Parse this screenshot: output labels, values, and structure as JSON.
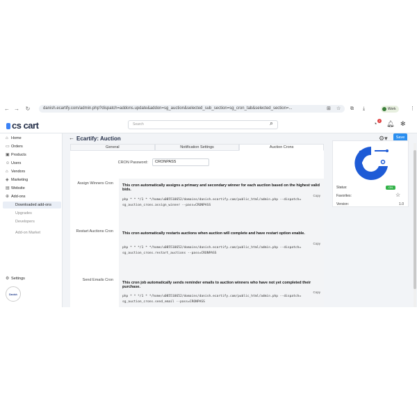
{
  "browser": {
    "url": "danish.ecartify.com/admin.php?dispatch=addons.update&addon=sg_auction&selected_sub_section=sg_cron_tab&selected_section=...",
    "profile_label": "Work"
  },
  "header": {
    "logo_text": "cs cart",
    "search_placeholder": "Search",
    "notification_count": "2"
  },
  "sidebar": {
    "items": [
      {
        "label": "Home",
        "icon": "home-icon"
      },
      {
        "label": "Orders",
        "icon": "orders-icon"
      },
      {
        "label": "Products",
        "icon": "products-icon"
      },
      {
        "label": "Users",
        "icon": "users-icon"
      },
      {
        "label": "Vendors",
        "icon": "vendors-icon"
      },
      {
        "label": "Marketing",
        "icon": "marketing-icon"
      },
      {
        "label": "Website",
        "icon": "website-icon"
      },
      {
        "label": "Add-ons",
        "icon": "addons-icon"
      },
      {
        "label": "Downloaded add-ons"
      },
      {
        "label": "Upgrades"
      },
      {
        "label": "Developers"
      },
      {
        "label": "Add-on Market"
      }
    ],
    "settings_label": "Settings",
    "avatar_text": "Danish Sharma"
  },
  "page": {
    "title": "Ecartify: Auction",
    "save_label": "Save",
    "tabs": [
      "General",
      "Notification Settings",
      "Auction Crons"
    ]
  },
  "cron": {
    "password_label": "CRON Password:",
    "password_value": "CRONPASS",
    "copy_label": "Copy",
    "blocks": [
      {
        "label": "Assign Winners Cron",
        "description": "This cron automatically assigns a primary and secondary winner for each auction based on the highest valid bids.",
        "command_line1": "php * * */1 * */home/u085510652/domains/danish.ecartify.com/public_html/admin.php --dispatch=",
        "command_line2": "sg_auction_crons.assign_winner --pass=CRONPASS"
      },
      {
        "label": "Restart Auctions Cron",
        "description": "This cron automatically restarts auctions when auction will complete and have restart option enable.",
        "command_line1": "php * * */1 * */home/u085510652/domains/danish.ecartify.com/public_html/admin.php --dispatch=",
        "command_line2": "sg_auction_crons.restart_auctions --pass=CRONPASS"
      },
      {
        "label": "Send Emails Cron",
        "description": "This cron job automatically sends reminder emails to auction winners who have not yet completed their purchase.",
        "command_line1": "php * * */1 * */home/u085510652/domains/danish.ecartify.com/public_html/admin.php --dispatch=",
        "command_line2": "sg_auction_crons.send_email --pass=CRONPASS"
      }
    ]
  },
  "addon_info": {
    "status_label": "Status:",
    "status_value": "ON",
    "favorites_label": "Favorites:",
    "version_label": "Version:",
    "version_value": "1.0"
  },
  "colors": {
    "accent": "#2b8ff0",
    "status_on": "#34b34a",
    "logo_blue": "#1e5bd6"
  }
}
